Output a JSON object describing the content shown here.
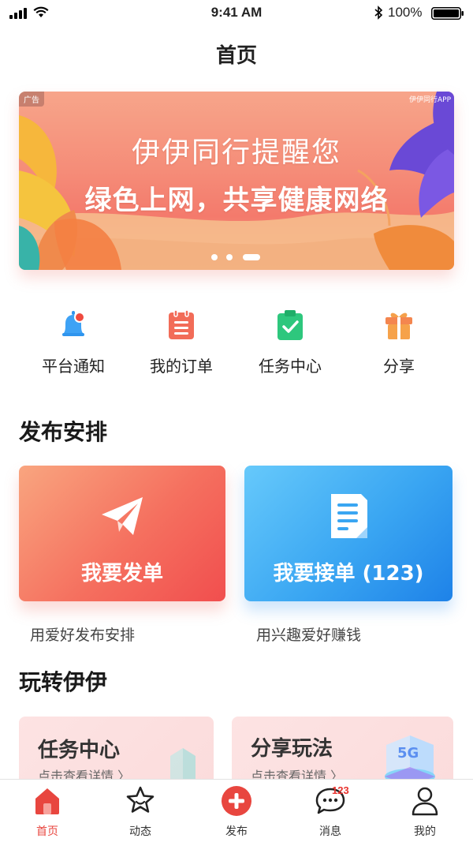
{
  "status_bar": {
    "time": "9:41 AM",
    "battery": "100%"
  },
  "nav": {
    "title": "首页"
  },
  "banner": {
    "ad_label": "广告",
    "app_mark": "伊伊同行APP",
    "line1": "伊伊同行提醒您",
    "line2": "绿色上网，共享健康网络",
    "pages": 3,
    "active_page": 3
  },
  "quick_menu": [
    {
      "label": "平台通知",
      "icon": "bell-icon"
    },
    {
      "label": "我的订单",
      "icon": "order-list-icon"
    },
    {
      "label": "任务中心",
      "icon": "clipboard-check-icon"
    },
    {
      "label": "分享",
      "icon": "gift-icon"
    }
  ],
  "publish": {
    "title": "发布安排",
    "send": {
      "label": "我要发单",
      "desc": "用爱好发布安排",
      "icon": "paper-plane-icon"
    },
    "take": {
      "label": "我要接单 (123)",
      "desc": "用兴趣爱好赚钱",
      "icon": "document-icon"
    }
  },
  "play": {
    "title": "玩转伊伊",
    "cards": [
      {
        "title": "任务中心",
        "subtitle": "点击查看详情 〉"
      },
      {
        "title": "分享玩法",
        "subtitle": "点击查看详情 〉"
      }
    ]
  },
  "tab_bar": {
    "items": [
      {
        "label": "首页",
        "icon": "home-icon",
        "active": true
      },
      {
        "label": "动态",
        "icon": "star-icon",
        "active": false
      },
      {
        "label": "发布",
        "icon": "plus-circle-icon",
        "active": false
      },
      {
        "label": "消息",
        "icon": "chat-bubble-icon",
        "active": false
      },
      {
        "label": "我的",
        "icon": "user-icon",
        "active": false
      }
    ],
    "message_badge": "123"
  },
  "colors": {
    "accent": "#e8463f",
    "blue": "#2f95ee",
    "orange": "#f4864f",
    "green": "#2ec77d"
  }
}
